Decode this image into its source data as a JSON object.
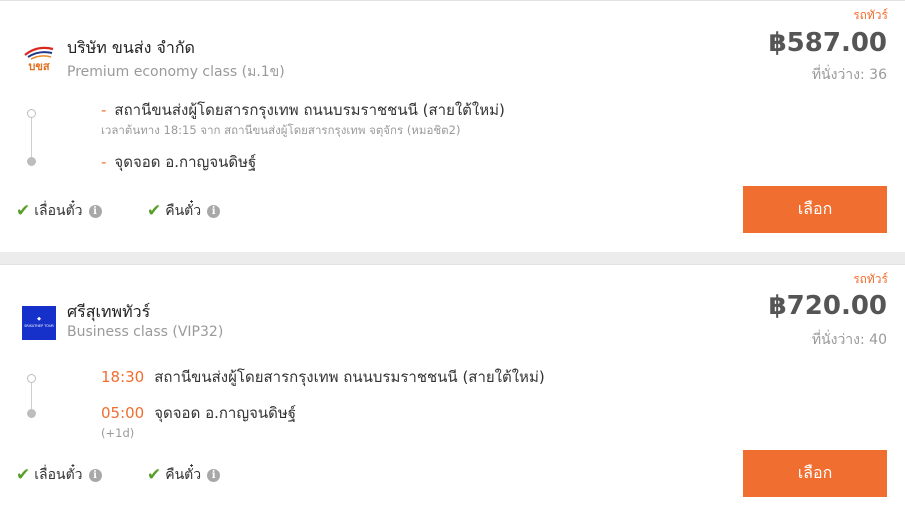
{
  "colors": {
    "accent": "#f06e30",
    "check": "#5a9e2a",
    "price": "#555555"
  },
  "trips": [
    {
      "tag": "รถทัวร์",
      "logo_text": "บขส",
      "company": "บริษัท ขนส่ง จำกัด",
      "bus_class": "Premium economy class (ม.1ข)",
      "price": "฿587.00",
      "seats": "ที่นั่งว่าง: 36",
      "departure": {
        "time": "",
        "station": "สถานีขนส่งผู้โดยสารกรุงเทพ ถนนบรมราชชนนี (สายใต้ใหม่)",
        "note": "เวลาต้นทาง 18:15   จาก สถานีขนส่งผู้โดยสารกรุงเทพ จตุจักร (หมอชิต2)"
      },
      "arrival": {
        "time": "",
        "station": "จุดจอด อ.กาญจนดิษฐ์",
        "note": ""
      },
      "features": [
        {
          "label": "เลื่อนตั๋ว",
          "icon": "check-icon"
        },
        {
          "label": "คืนตั๋ว",
          "icon": "check-icon"
        }
      ],
      "button_label": "เลือก"
    },
    {
      "tag": "รถทัวร์",
      "logo_text": "SRISUTHEP TOUR",
      "company": "ศรีสุเทพทัวร์",
      "bus_class": "Business class (VIP32)",
      "price": "฿720.00",
      "seats": "ที่นั่งว่าง: 40",
      "departure": {
        "time": "18:30",
        "station": "สถานีขนส่งผู้โดยสารกรุงเทพ ถนนบรมราชชนนี (สายใต้ใหม่)",
        "note": ""
      },
      "arrival": {
        "time": "05:00",
        "station": "จุดจอด อ.กาญจนดิษฐ์",
        "note": "(+1d)"
      },
      "features": [
        {
          "label": "เลื่อนตั๋ว",
          "icon": "check-icon"
        },
        {
          "label": "คืนตั๋ว",
          "icon": "check-icon"
        }
      ],
      "button_label": "เลือก"
    }
  ]
}
